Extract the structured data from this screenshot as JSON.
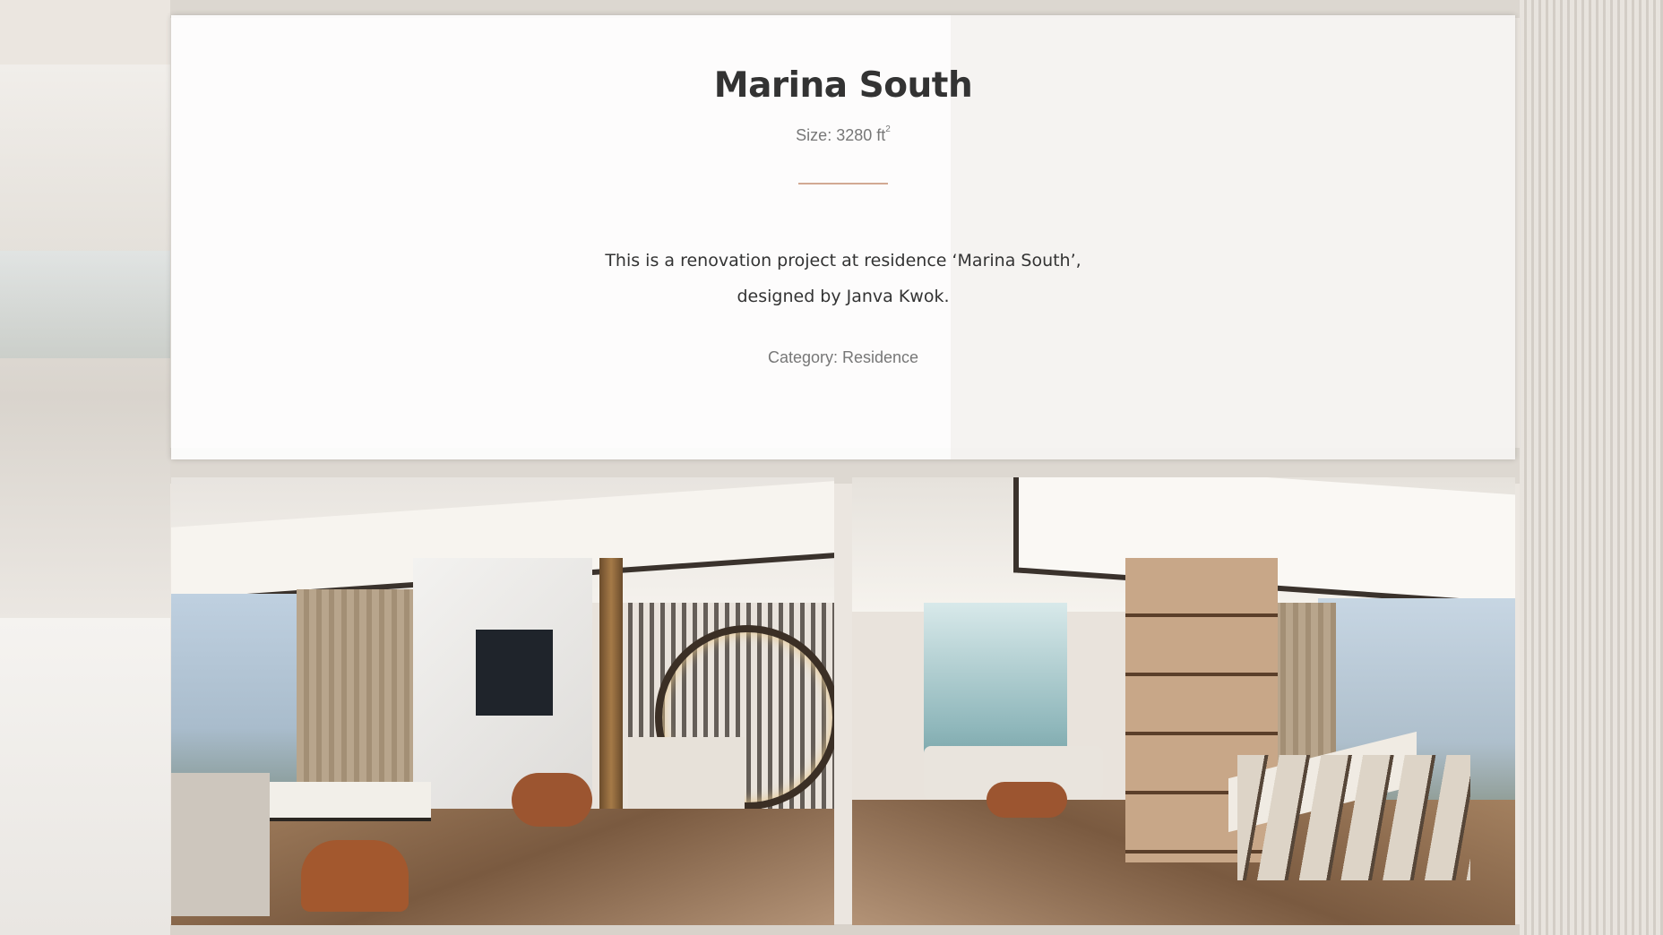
{
  "project": {
    "title": "Marina South",
    "size_label": "Size: 3280 ft",
    "size_unit_sup": "2",
    "description": "This is a renovation project at residence ‘Marina South’, designed by Janva Kwok.",
    "category_label": "Category: Residence"
  },
  "colors": {
    "divider_accent": "#d2a993",
    "title_text": "#333333",
    "muted_text": "#777777"
  },
  "gallery": {
    "images": [
      "living-room-render",
      "dining-room-render"
    ]
  }
}
